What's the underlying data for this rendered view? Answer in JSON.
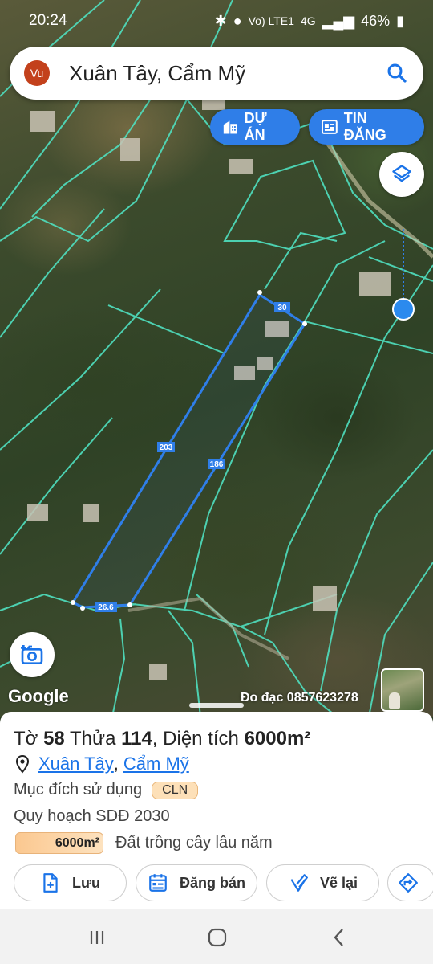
{
  "status_bar": {
    "time": "20:24",
    "network": "Vo) LTE1",
    "net_type": "4G",
    "battery": "46%"
  },
  "search": {
    "avatar_text": "Vu",
    "query": "Xuân Tây, Cẩm Mỹ"
  },
  "chips": {
    "du_an": "DỰ ÁN",
    "tin_dang": "TIN ĐĂNG"
  },
  "map": {
    "edge_labels": [
      "30",
      "203",
      "186",
      "26.6"
    ],
    "google_label": "Google",
    "measure_text": "Đo đạc 0857623278",
    "parcel_color": "#2f7ee8",
    "boundary_color": "#4fe0c0"
  },
  "parcel": {
    "title_prefix": "Tờ",
    "sheet_no": "58",
    "plot_label": "Thửa",
    "plot_no": "114",
    "area_label": "Diện tích",
    "area_value": "6000m²",
    "location_commune": "Xuân Tây",
    "location_sep": ",",
    "location_district": "Cẩm Mỹ",
    "purpose_label": "Mục đích sử dụng",
    "purpose_code": "CLN",
    "plan_label": "Quy hoạch SDĐ 2030",
    "plan_area": "6000m²",
    "plan_desc": "Đất trồng cây lâu năm"
  },
  "actions": {
    "save": "Lưu",
    "sell": "Đăng bán",
    "redraw": "Vẽ lại"
  },
  "nav": {
    "recent": "recent-apps-icon",
    "home": "home-icon",
    "back": "back-icon"
  }
}
